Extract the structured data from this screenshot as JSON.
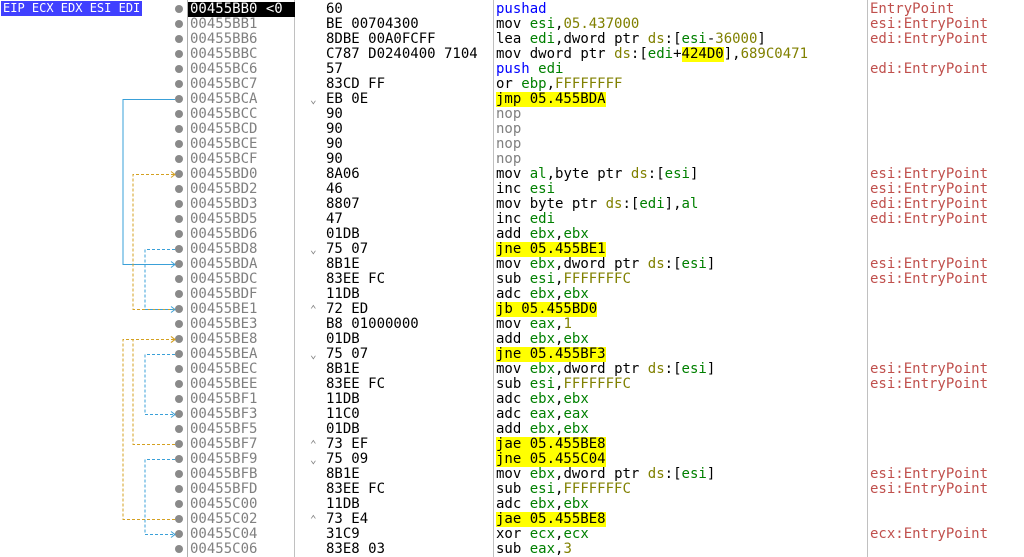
{
  "registers_label": "EIP ECX EDX ESI EDI",
  "colors": {
    "address_gray": "#808080",
    "current_row_bg": "#000000",
    "comment_red": "#c0504d",
    "jump_highlight": "#ffff00",
    "register_green": "#008000",
    "pushad_blue": "#0000ff",
    "jump_line_blue": "#3aa0d8",
    "jump_line_yellow": "#d4a020"
  },
  "rows": [
    {
      "addr": "00455BB0 <0",
      "arrow": "",
      "bytes": "60",
      "disasm": "pushad",
      "comment": "EntryPoint",
      "current": true
    },
    {
      "addr": "00455BB1",
      "arrow": "",
      "bytes": "BE 00704300",
      "disasm": "mov esi,05.437000",
      "comment": "esi:EntryPoint"
    },
    {
      "addr": "00455BB6",
      "arrow": "",
      "bytes": "8DBE 00A0FCFF",
      "disasm": "lea edi,dword ptr ds:[esi-36000]",
      "comment": "edi:EntryPoint"
    },
    {
      "addr": "00455BBC",
      "arrow": "",
      "bytes": "C787 D0240400 7104",
      "disasm": "mov dword ptr ds:[edi+424D0],689C0471",
      "comment": ""
    },
    {
      "addr": "00455BC6",
      "arrow": "",
      "bytes": "57",
      "disasm": "push edi",
      "comment": "edi:EntryPoint"
    },
    {
      "addr": "00455BC7",
      "arrow": "",
      "bytes": "83CD FF",
      "disasm": "or ebp,FFFFFFFF",
      "comment": ""
    },
    {
      "addr": "00455BCA",
      "arrow": "v",
      "bytes": "EB 0E",
      "disasm": "jmp 05.455BDA",
      "comment": ""
    },
    {
      "addr": "00455BCC",
      "arrow": "",
      "bytes": "90",
      "disasm": "nop",
      "comment": ""
    },
    {
      "addr": "00455BCD",
      "arrow": "",
      "bytes": "90",
      "disasm": "nop",
      "comment": ""
    },
    {
      "addr": "00455BCE",
      "arrow": "",
      "bytes": "90",
      "disasm": "nop",
      "comment": ""
    },
    {
      "addr": "00455BCF",
      "arrow": "",
      "bytes": "90",
      "disasm": "nop",
      "comment": ""
    },
    {
      "addr": "00455BD0",
      "arrow": "",
      "bytes": "8A06",
      "disasm": "mov al,byte ptr ds:[esi]",
      "comment": "esi:EntryPoint"
    },
    {
      "addr": "00455BD2",
      "arrow": "",
      "bytes": "46",
      "disasm": "inc esi",
      "comment": "esi:EntryPoint"
    },
    {
      "addr": "00455BD3",
      "arrow": "",
      "bytes": "8807",
      "disasm": "mov byte ptr ds:[edi],al",
      "comment": "edi:EntryPoint"
    },
    {
      "addr": "00455BD5",
      "arrow": "",
      "bytes": "47",
      "disasm": "inc edi",
      "comment": "edi:EntryPoint"
    },
    {
      "addr": "00455BD6",
      "arrow": "",
      "bytes": "01DB",
      "disasm": "add ebx,ebx",
      "comment": ""
    },
    {
      "addr": "00455BD8",
      "arrow": "v",
      "bytes": "75 07",
      "disasm": "jne 05.455BE1",
      "comment": ""
    },
    {
      "addr": "00455BDA",
      "arrow": "",
      "bytes": "8B1E",
      "disasm": "mov ebx,dword ptr ds:[esi]",
      "comment": "esi:EntryPoint"
    },
    {
      "addr": "00455BDC",
      "arrow": "",
      "bytes": "83EE FC",
      "disasm": "sub esi,FFFFFFFC",
      "comment": "esi:EntryPoint"
    },
    {
      "addr": "00455BDF",
      "arrow": "",
      "bytes": "11DB",
      "disasm": "adc ebx,ebx",
      "comment": ""
    },
    {
      "addr": "00455BE1",
      "arrow": "^",
      "bytes": "72 ED",
      "disasm": "jb 05.455BD0",
      "comment": ""
    },
    {
      "addr": "00455BE3",
      "arrow": "",
      "bytes": "B8 01000000",
      "disasm": "mov eax,1",
      "comment": ""
    },
    {
      "addr": "00455BE8",
      "arrow": "",
      "bytes": "01DB",
      "disasm": "add ebx,ebx",
      "comment": ""
    },
    {
      "addr": "00455BEA",
      "arrow": "v",
      "bytes": "75 07",
      "disasm": "jne 05.455BF3",
      "comment": ""
    },
    {
      "addr": "00455BEC",
      "arrow": "",
      "bytes": "8B1E",
      "disasm": "mov ebx,dword ptr ds:[esi]",
      "comment": "esi:EntryPoint"
    },
    {
      "addr": "00455BEE",
      "arrow": "",
      "bytes": "83EE FC",
      "disasm": "sub esi,FFFFFFFC",
      "comment": "esi:EntryPoint"
    },
    {
      "addr": "00455BF1",
      "arrow": "",
      "bytes": "11DB",
      "disasm": "adc ebx,ebx",
      "comment": ""
    },
    {
      "addr": "00455BF3",
      "arrow": "",
      "bytes": "11C0",
      "disasm": "adc eax,eax",
      "comment": ""
    },
    {
      "addr": "00455BF5",
      "arrow": "",
      "bytes": "01DB",
      "disasm": "add ebx,ebx",
      "comment": ""
    },
    {
      "addr": "00455BF7",
      "arrow": "^",
      "bytes": "73 EF",
      "disasm": "jae 05.455BE8",
      "comment": ""
    },
    {
      "addr": "00455BF9",
      "arrow": "v",
      "bytes": "75 09",
      "disasm": "jne 05.455C04",
      "comment": ""
    },
    {
      "addr": "00455BFB",
      "arrow": "",
      "bytes": "8B1E",
      "disasm": "mov ebx,dword ptr ds:[esi]",
      "comment": "esi:EntryPoint"
    },
    {
      "addr": "00455BFD",
      "arrow": "",
      "bytes": "83EE FC",
      "disasm": "sub esi,FFFFFFFC",
      "comment": "esi:EntryPoint"
    },
    {
      "addr": "00455C00",
      "arrow": "",
      "bytes": "11DB",
      "disasm": "adc ebx,ebx",
      "comment": ""
    },
    {
      "addr": "00455C02",
      "arrow": "^",
      "bytes": "73 E4",
      "disasm": "jae 05.455BE8",
      "comment": ""
    },
    {
      "addr": "00455C04",
      "arrow": "",
      "bytes": "31C9",
      "disasm": "xor ecx,ecx",
      "comment": "ecx:EntryPoint"
    },
    {
      "addr": "00455C06",
      "arrow": "",
      "bytes": "83E8 03",
      "disasm": "sub eax,3",
      "comment": ""
    }
  ]
}
